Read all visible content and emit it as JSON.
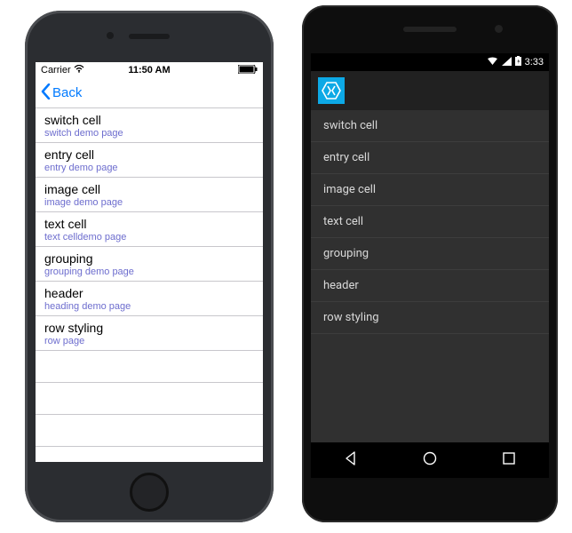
{
  "ios": {
    "status": {
      "carrier": "Carrier",
      "time": "11:50 AM"
    },
    "nav": {
      "back": "Back"
    },
    "cells": [
      {
        "title": "switch cell",
        "detail": "switch demo page"
      },
      {
        "title": "entry cell",
        "detail": "entry demo page"
      },
      {
        "title": "image cell",
        "detail": "image demo page"
      },
      {
        "title": "text cell",
        "detail": "text celldemo page"
      },
      {
        "title": "grouping",
        "detail": "grouping demo page"
      },
      {
        "title": "header",
        "detail": "heading demo page"
      },
      {
        "title": "row styling",
        "detail": "row page"
      }
    ]
  },
  "android": {
    "status": {
      "time": "3:33"
    },
    "cells": [
      {
        "title": "switch cell"
      },
      {
        "title": "entry cell"
      },
      {
        "title": "image cell"
      },
      {
        "title": "text cell"
      },
      {
        "title": "grouping"
      },
      {
        "title": "header"
      },
      {
        "title": "row styling"
      }
    ]
  }
}
